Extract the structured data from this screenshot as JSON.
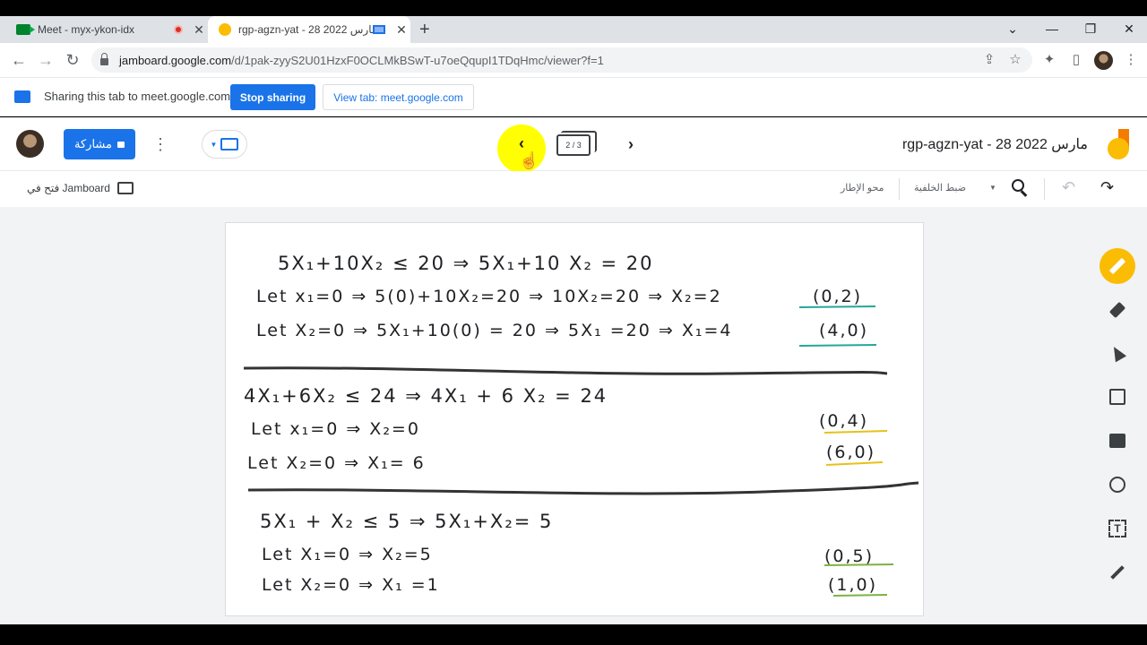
{
  "tabs": [
    {
      "title": "Meet - myx-ykon-idx",
      "favicon": "meet-icon",
      "status": "recording"
    },
    {
      "title": "rgp-agzn-yat - 28 مارس 2022",
      "favicon": "jamboard-icon",
      "status": "casting"
    }
  ],
  "url": {
    "host": "jamboard.google.com",
    "path": "/d/1pak-zyyS2U01HzxF0OCLMkBSwT-u7oeQqupI1TDqHmc/viewer?f=1"
  },
  "sharebar": {
    "message": "Sharing this tab to meet.google.com",
    "stop_label": "Stop sharing",
    "view_label": "View tab: meet.google.com"
  },
  "jamboard": {
    "share_label": "مشاركة",
    "frame_counter": "2 / 3",
    "title": "rgp-agzn-yat - 28 مارس 2022",
    "open_in_label": "فتح في Jamboard",
    "set_background_label": "ضبط الخلفية",
    "clear_frame_label": "محو الإطار"
  },
  "board": {
    "lines": [
      "5X₁+10X₂ ≤ 20 ⇒ 5X₁+10 X₂ = 20",
      "Let x₁=0 ⇒ 5(0)+10X₂=20 ⇒ 10X₂=20 ⇒ X₂=2",
      "Let X₂=0 ⇒ 5X₁+10(0) = 20 ⇒ 5X₁ =20 ⇒ X₁=4",
      "4X₁+6X₂ ≤ 24 ⇒ 4X₁ + 6 X₂ = 24",
      "Let x₁=0 ⇒ X₂=0",
      "Let X₂=0 ⇒ X₁= 6",
      "5X₁ + X₂ ≤ 5 ⇒ 5X₁+X₂= 5",
      "Let X₁=0 ⇒ X₂=5",
      "Let X₂=0 ⇒ X₁ =1"
    ],
    "points": [
      "(0,2)",
      "(4,0)",
      "(0,4)",
      "(6,0)",
      "(0,5)",
      "(1,0)"
    ],
    "underline_colors": [
      "#26a69a",
      "#26a69a",
      "#e6c21a",
      "#e6c21a",
      "#7cb342",
      "#7cb342"
    ]
  },
  "colors": {
    "accent": "#1a73e8",
    "jamboard": "#fbbc04",
    "highlight": "#ffff00"
  }
}
